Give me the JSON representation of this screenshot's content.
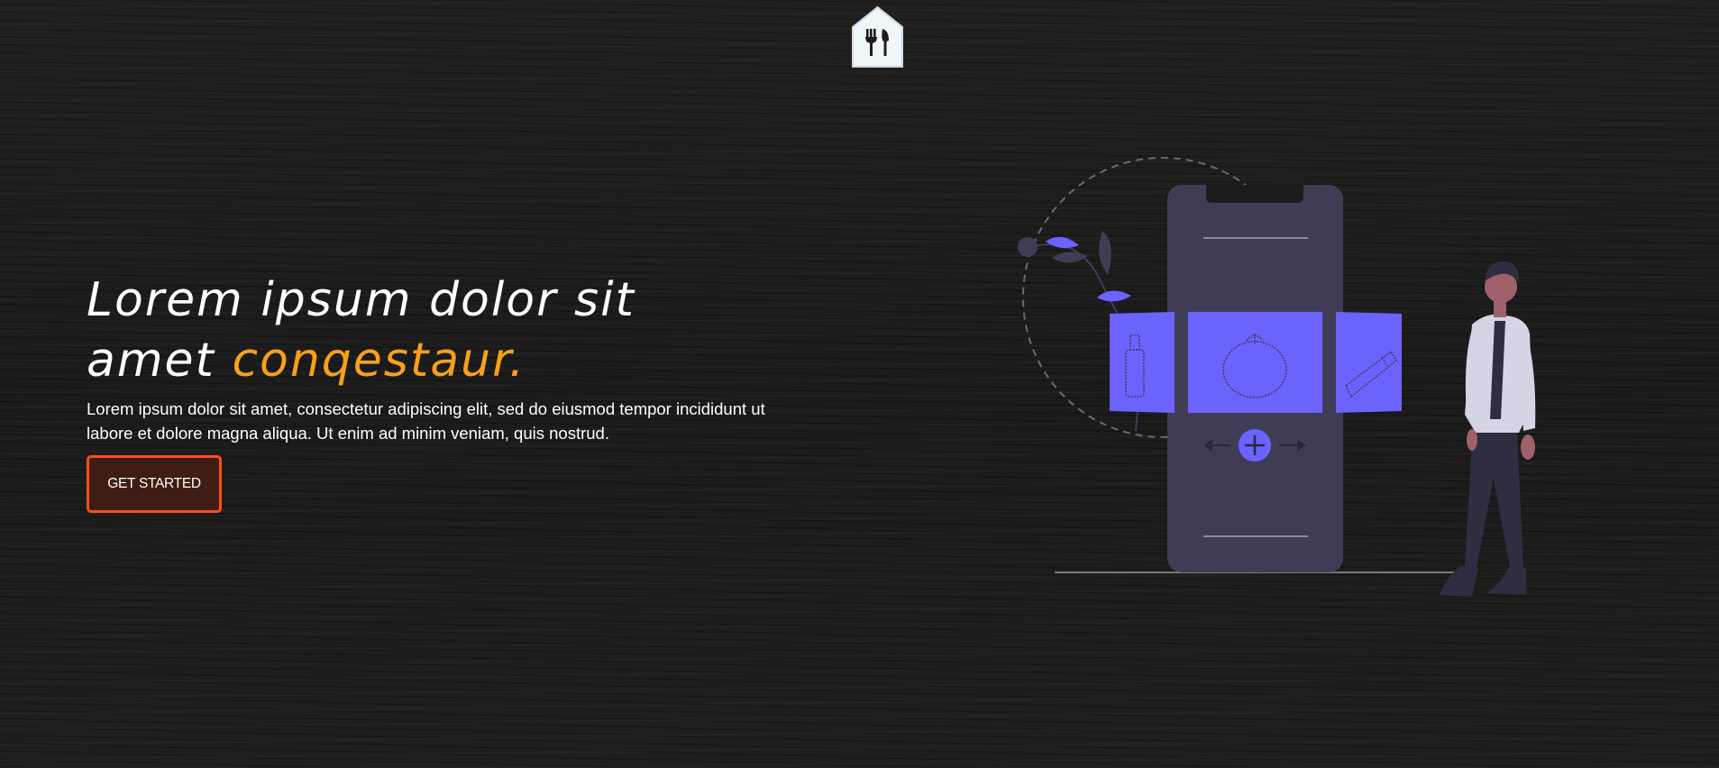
{
  "header": {
    "logo_icon": "fork-knife-house-icon"
  },
  "hero": {
    "headline_line1": "Lorem ipsum dolor sit",
    "headline_line2_prefix": "amet",
    "headline_accent": "conqestaur.",
    "description": "Lorem ipsum dolor sit amet, consectetur adipiscing elit, sed do eiusmod tempor incididunt ut labore et dolore magna aliqua. Ut enim ad minim veniam, quis nostrud.",
    "cta_label": "GET STARTED"
  },
  "illustration": {
    "subject": "person-with-phone-food-menu-illustration",
    "icons": [
      "bottle-icon",
      "tomato-icon",
      "carrot-icon",
      "plus-icon",
      "arrow-left-icon",
      "arrow-right-icon",
      "leaf-branch-icon"
    ]
  },
  "colors": {
    "background": "#1d1c1c",
    "accent_orange": "#f4a11c",
    "button_border": "#ff4f13",
    "button_fill": "#3f1d12",
    "illustration_purple": "#6c63ff",
    "phone_body": "#3f3d56"
  }
}
